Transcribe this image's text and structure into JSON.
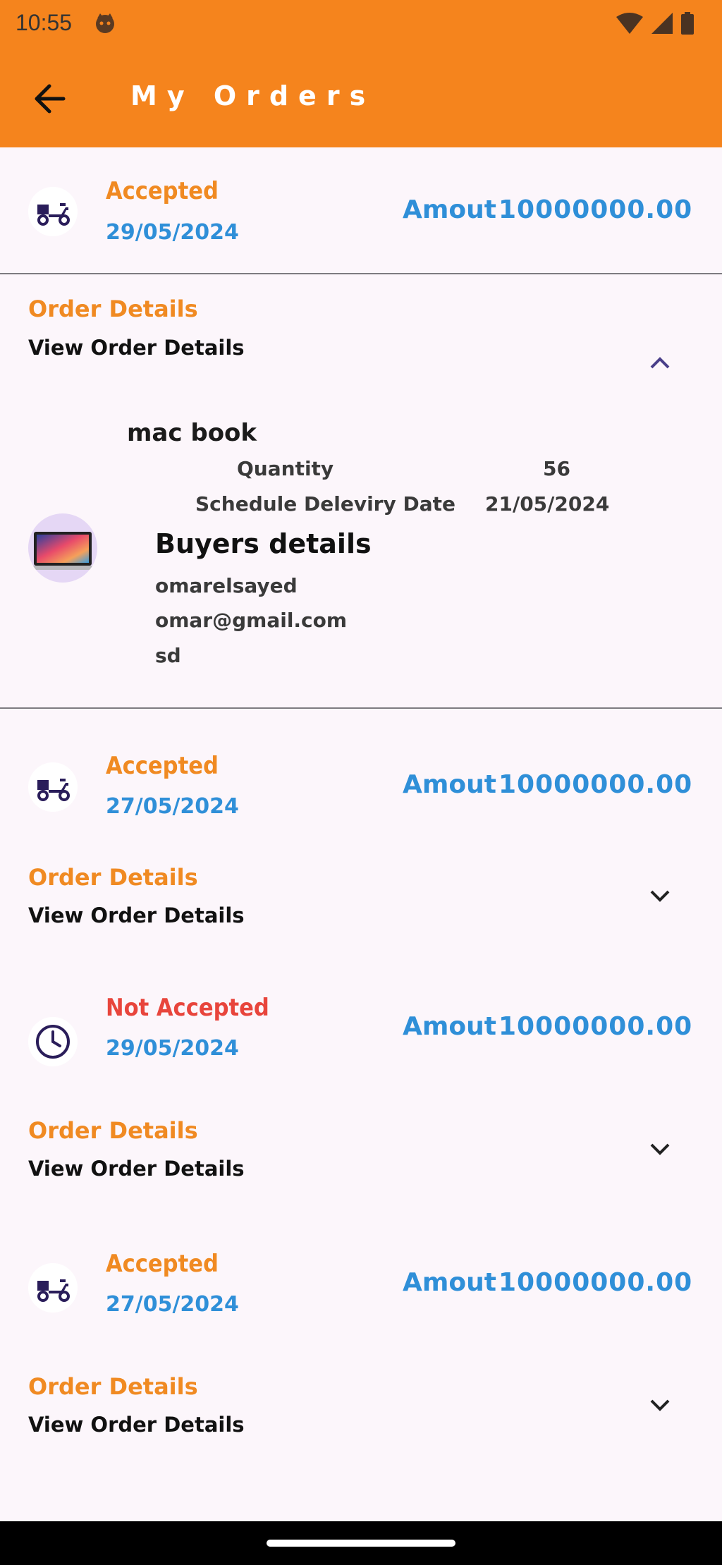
{
  "status_bar": {
    "time": "10:55"
  },
  "app_bar": {
    "title": "My Orders"
  },
  "orders": [
    {
      "status": "Accepted",
      "status_color": "#f08a22",
      "date": "29/05/2024",
      "amount_label": "Amout",
      "amount": "10000000.00",
      "icon": "delivery-scooter-icon",
      "details_title": "Order Details",
      "details_sub": "View Order Details",
      "expanded": true,
      "product": {
        "name": "mac book",
        "quantity_label": "Quantity",
        "quantity": "56",
        "schedule_label": "Schedule Deleviry Date",
        "schedule": "21/05/2024"
      },
      "buyer": {
        "title": "Buyers details",
        "name": "omarelsayed",
        "email": "omar@gmail.com",
        "address": "sd"
      }
    },
    {
      "status": "Accepted",
      "status_color": "#f08a22",
      "date": "27/05/2024",
      "amount_label": "Amout",
      "amount": "10000000.00",
      "icon": "delivery-scooter-icon",
      "details_title": "Order Details",
      "details_sub": "View Order Details",
      "expanded": false
    },
    {
      "status": "Not Accepted",
      "status_color": "#e8453c",
      "date": "29/05/2024",
      "amount_label": "Amout",
      "amount": "10000000.00",
      "icon": "clock-icon",
      "details_title": "Order Details",
      "details_sub": "View Order Details",
      "expanded": false
    },
    {
      "status": "Accepted",
      "status_color": "#f08a22",
      "date": "27/05/2024",
      "amount_label": "Amout",
      "amount": "10000000.00",
      "icon": "delivery-scooter-icon",
      "details_title": "Order Details",
      "details_sub": "View Order Details",
      "expanded": false
    }
  ],
  "colors": {
    "accent": "#f5841d",
    "link_blue": "#2f8fd8",
    "error_red": "#e8453c",
    "icon_navy": "#2a1d5a"
  }
}
